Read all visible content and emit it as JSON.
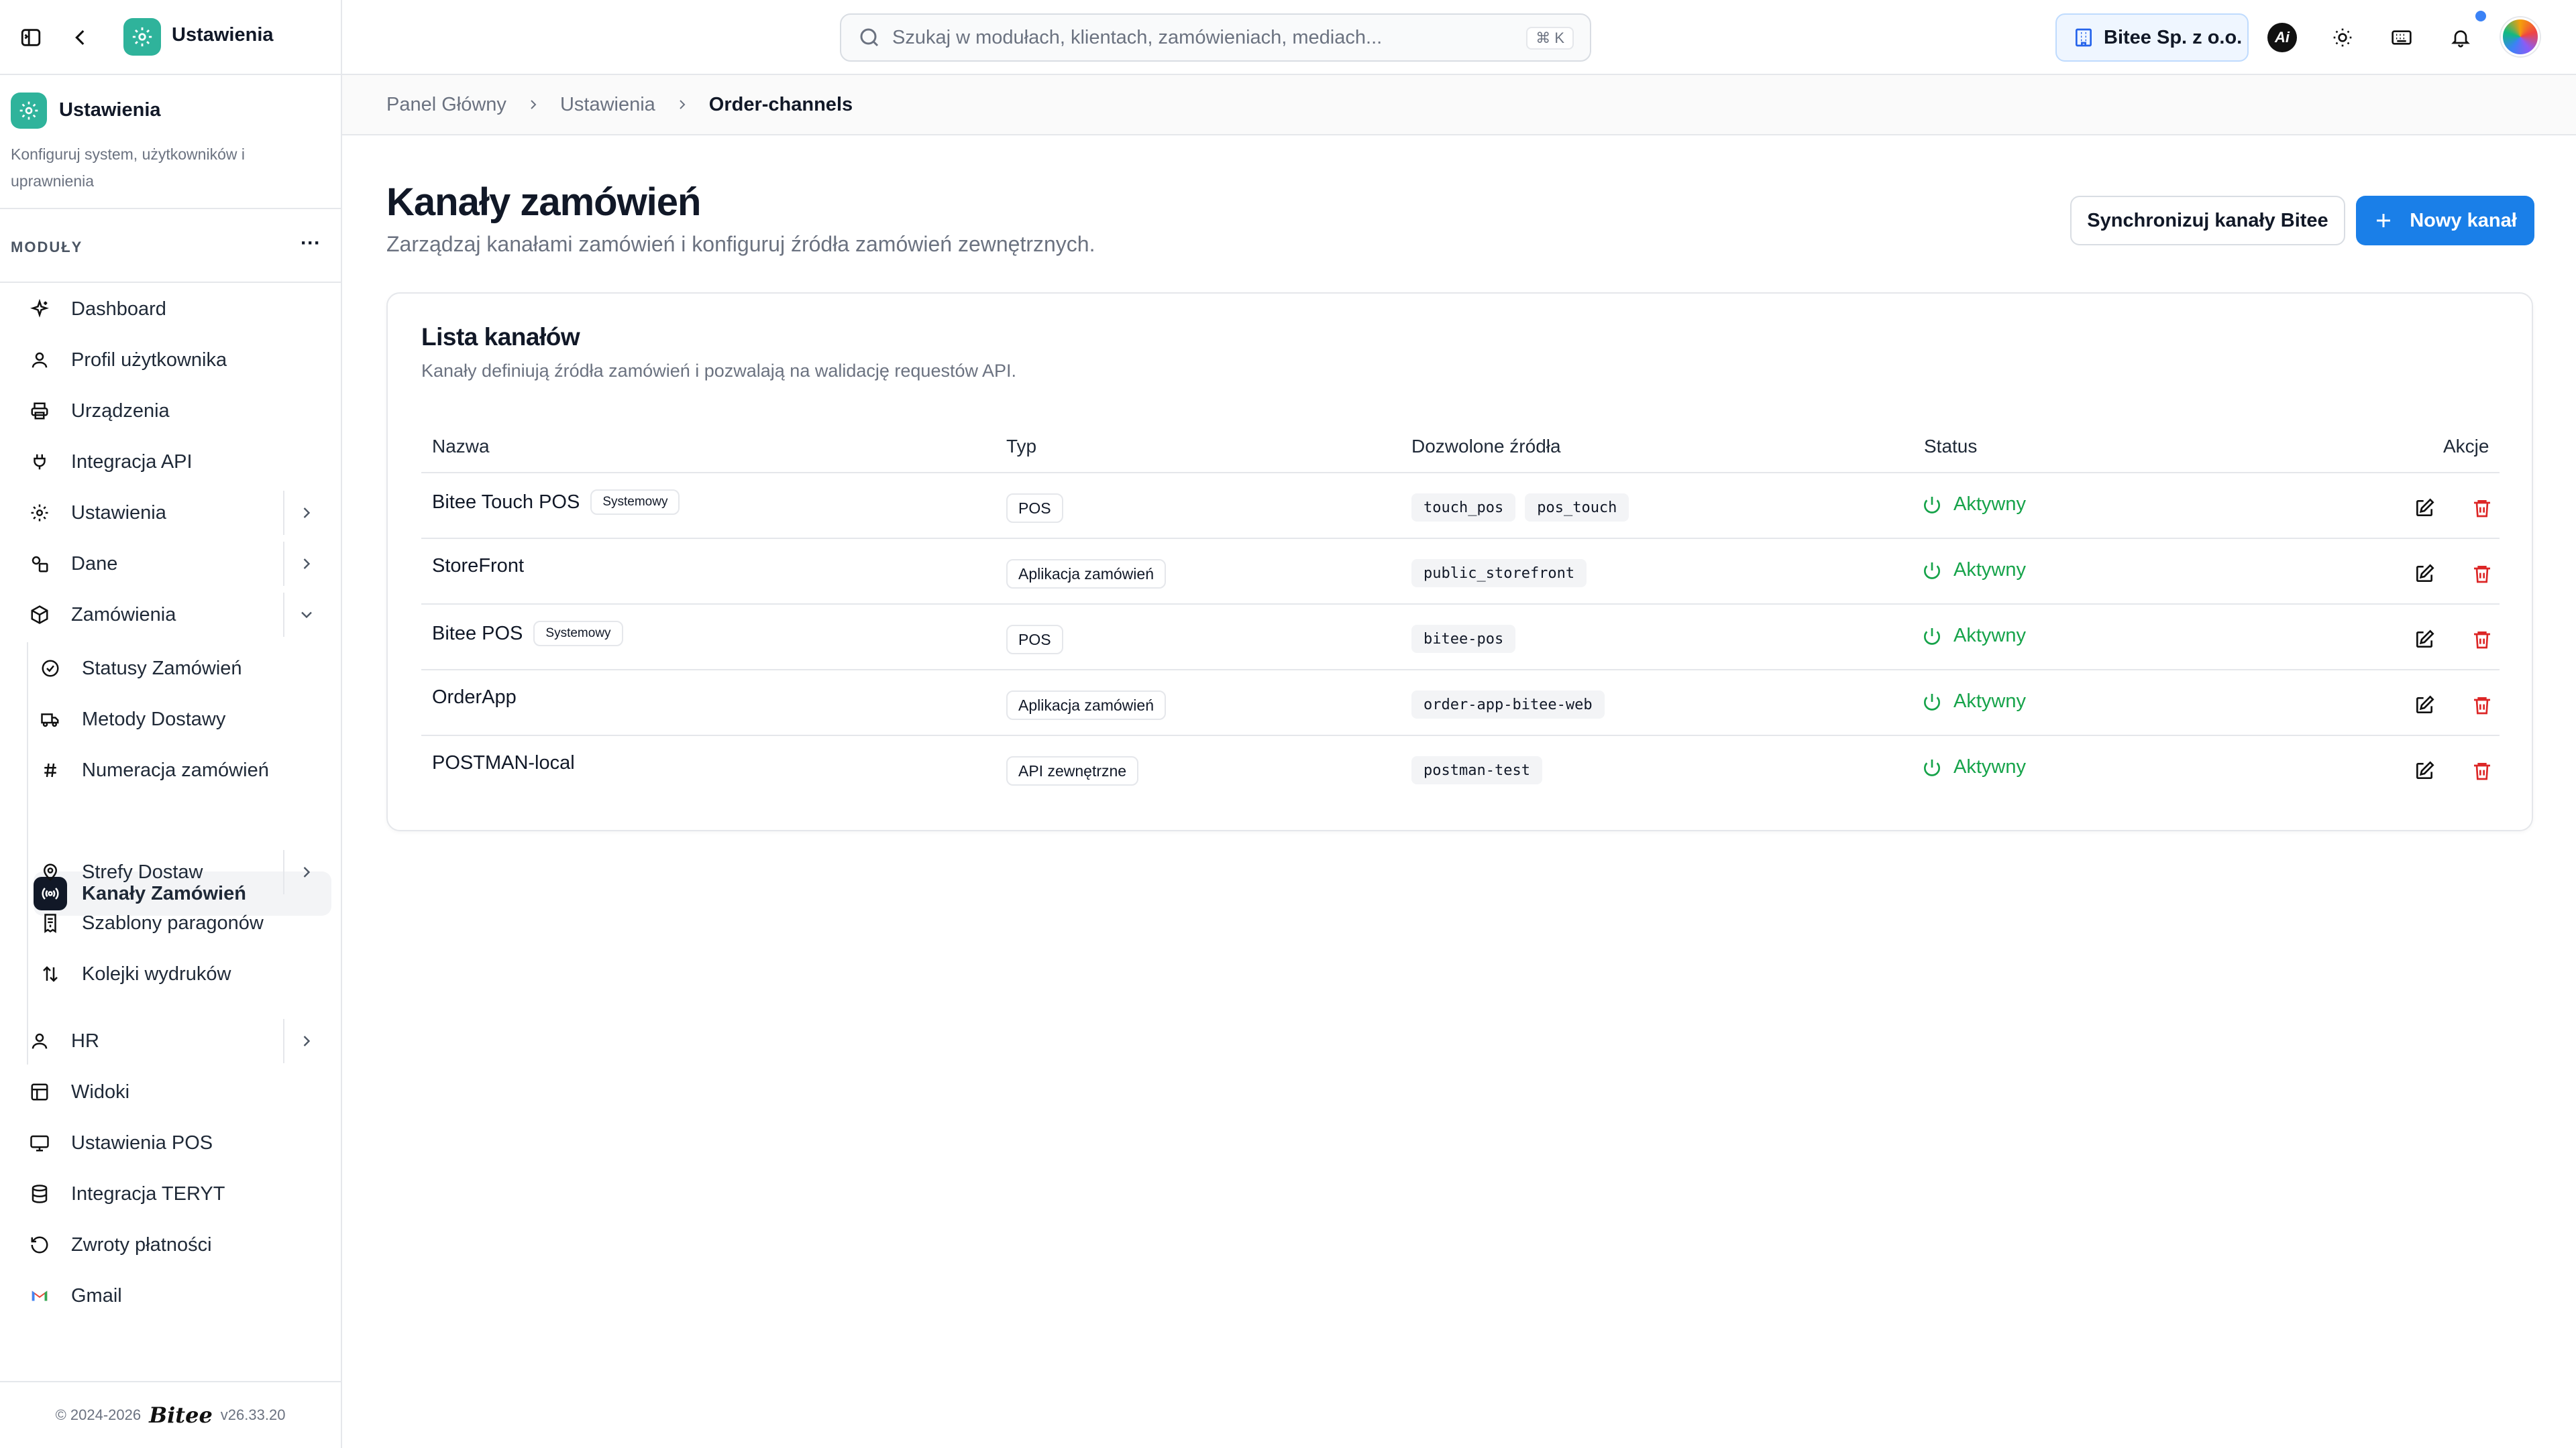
{
  "app": {
    "title": "Ustawienia"
  },
  "search": {
    "placeholder": "Szukaj w modułach, klientach, zamówieniach, mediach...",
    "shortcut": "⌘ K"
  },
  "company": {
    "name": "Bitee Sp. z o.o."
  },
  "topbar_icons": [
    "sidebar-toggle-icon",
    "back-arrow-icon",
    "ai-icon",
    "sun-icon",
    "keyboard-icon",
    "bell-icon",
    "avatar"
  ],
  "ai_badge": "Ai",
  "sidebar": {
    "title": "Ustawienia",
    "description": "Konfiguruj system, użytkowników i uprawnienia",
    "modules_label": "MODUŁY",
    "more": "···",
    "items": [
      {
        "label": "Dashboard",
        "icon": "sparkle-icon"
      },
      {
        "label": "Profil użytkownika",
        "icon": "user-icon"
      },
      {
        "label": "Urządzenia",
        "icon": "printer-icon"
      },
      {
        "label": "Integracja API",
        "icon": "plug-icon"
      },
      {
        "label": "Ustawienia",
        "icon": "gear-icon",
        "expandable": true
      },
      {
        "label": "Dane",
        "icon": "shapes-icon",
        "expandable": true
      },
      {
        "label": "Zamówienia",
        "icon": "box-icon",
        "expanded": true
      },
      {
        "label": "HR",
        "icon": "user-icon",
        "expandable": true
      },
      {
        "label": "Widoki",
        "icon": "layout-icon"
      },
      {
        "label": "Ustawienia POS",
        "icon": "monitor-icon"
      },
      {
        "label": "Integracja TERYT",
        "icon": "database-icon"
      },
      {
        "label": "Zwroty płatności",
        "icon": "refresh-icon"
      },
      {
        "label": "Gmail",
        "icon": "gmail-icon"
      }
    ],
    "sub_items": [
      {
        "label": "Statusy Zamówień",
        "icon": "check-circle-icon"
      },
      {
        "label": "Metody Dostawy",
        "icon": "truck-icon"
      },
      {
        "label": "Numeracja zamówień",
        "icon": "hash-icon"
      },
      {
        "label": "Kanały Zamówień",
        "icon": "broadcast-icon",
        "active": true
      },
      {
        "label": "Strefy Dostaw",
        "icon": "map-pin-icon",
        "expandable": true
      },
      {
        "label": "Szablony paragonów",
        "icon": "receipt-icon"
      },
      {
        "label": "Kolejki wydruków",
        "icon": "arrows-up-down-icon"
      }
    ],
    "footer": {
      "copyright": "© 2024-2026",
      "brand": "Bitee",
      "version": "v26.33.20"
    }
  },
  "breadcrumb": {
    "items": [
      "Panel Główny",
      "Ustawienia"
    ],
    "current": "Order-channels"
  },
  "page": {
    "title": "Kanały zamówień",
    "subtitle": "Zarządzaj kanałami zamówień i konfiguruj źródła zamówień zewnętrznych.",
    "sync_button": "Synchronizuj kanały Bitee",
    "new_button": "Nowy kanał"
  },
  "card": {
    "title": "Lista kanałów",
    "subtitle": "Kanały definiują źródła zamówień i pozwalają na walidację requestów API.",
    "columns": [
      "Nazwa",
      "Typ",
      "Dozwolone źródła",
      "Status",
      "Akcje"
    ],
    "rows": [
      {
        "name": "Bitee Touch POS",
        "badge": "Systemowy",
        "type": "POS",
        "sources": [
          "touch_pos",
          "pos_touch"
        ],
        "status": "Aktywny"
      },
      {
        "name": "StoreFront",
        "badge": "",
        "type": "Aplikacja zamówień",
        "sources": [
          "public_storefront"
        ],
        "status": "Aktywny"
      },
      {
        "name": "Bitee POS",
        "badge": "Systemowy",
        "type": "POS",
        "sources": [
          "bitee-pos"
        ],
        "status": "Aktywny"
      },
      {
        "name": "OrderApp",
        "badge": "",
        "type": "Aplikacja zamówień",
        "sources": [
          "order-app-bitee-web"
        ],
        "status": "Aktywny"
      },
      {
        "name": "POSTMAN-local",
        "badge": "",
        "type": "API zewnętrzne",
        "sources": [
          "postman-test"
        ],
        "status": "Aktywny"
      }
    ]
  },
  "colors": {
    "accent": "#1a7fe8",
    "brand": "#2fb39b",
    "active_status": "#16a34a",
    "danger": "#dc2626"
  }
}
